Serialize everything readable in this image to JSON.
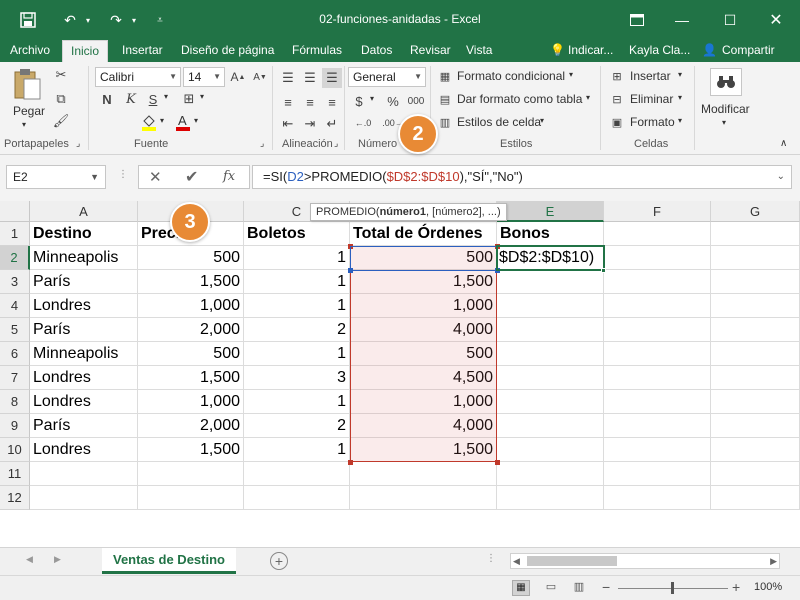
{
  "titlebar": {
    "title": "02-funciones-anidadas - Excel"
  },
  "menu": {
    "tabs": [
      "Archivo",
      "Inicio",
      "Insertar",
      "Diseño de página",
      "Fórmulas",
      "Datos",
      "Revisar",
      "Vista"
    ],
    "active_tab": "Inicio",
    "tell_me": "Indicar...",
    "user": "Kayla Cla...",
    "share": "Compartir"
  },
  "ribbon": {
    "clipboard": {
      "paste": "Pegar",
      "label": "Portapapeles"
    },
    "font": {
      "name": "Calibri",
      "size": "14",
      "label": "Fuente"
    },
    "alignment": {
      "label": "Alineación"
    },
    "number": {
      "format": "General",
      "currency": "$",
      "percent": "%",
      "comma": "000",
      "label": "Número"
    },
    "styles": {
      "conditional": "Formato condicional",
      "table": "Dar formato como tabla",
      "cell_styles": "Estilos de celda",
      "label": "Estilos"
    },
    "cells": {
      "insert": "Insertar",
      "delete": "Eliminar",
      "format": "Formato",
      "label": "Celdas"
    },
    "editing": {
      "modify": "Modificar"
    }
  },
  "formula_bar": {
    "name_box": "E2",
    "fx": "fx",
    "formula_prefix": "=SI(",
    "formula_ref1": "D2",
    "formula_mid": ">PROMEDIO(",
    "formula_ref2": "$D$2:$D$10",
    "formula_suffix": "),\"SÍ\",\"No\")"
  },
  "tooltip": {
    "fn": "PROMEDIO(",
    "arg1": "número1",
    "rest": ", [número2], ...)"
  },
  "columns": [
    "A",
    "B",
    "C",
    "D",
    "E",
    "F",
    "G"
  ],
  "sheet": {
    "headers": [
      "Destino",
      "Precio",
      "Boletos",
      "Total de Órdenes",
      "Bonos"
    ],
    "rows": [
      [
        "Minneapolis",
        "500",
        "1",
        "500"
      ],
      [
        "París",
        "1,500",
        "1",
        "1,500"
      ],
      [
        "Londres",
        "1,000",
        "1",
        "1,000"
      ],
      [
        "París",
        "2,000",
        "2",
        "4,000"
      ],
      [
        "Minneapolis",
        "500",
        "1",
        "500"
      ],
      [
        "Londres",
        "1,500",
        "3",
        "4,500"
      ],
      [
        "Londres",
        "1,000",
        "1",
        "1,000"
      ],
      [
        "París",
        "2,000",
        "2",
        "4,000"
      ],
      [
        "Londres",
        "1,500",
        "1",
        "1,500"
      ]
    ],
    "active_cell_text": "$D$2:$D$10)",
    "row_numbers": [
      "1",
      "2",
      "3",
      "4",
      "5",
      "6",
      "7",
      "8",
      "9",
      "10",
      "11",
      "12"
    ]
  },
  "callouts": {
    "a": "2",
    "b": "3"
  },
  "sheet_tab": "Ventas de Destino",
  "status": {
    "zoom": "100%"
  },
  "colors": {
    "accent": "#217346",
    "callout": "#e88a35",
    "range": "#c0392b",
    "ref": "#2b5fbf"
  }
}
